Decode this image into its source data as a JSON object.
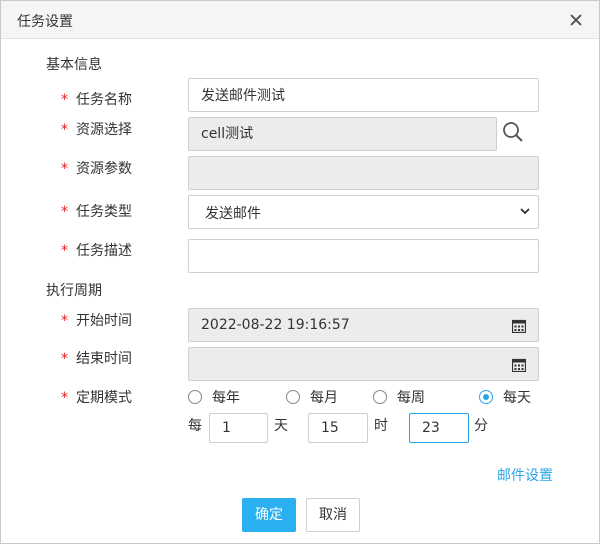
{
  "dialog": {
    "title": "任务设置"
  },
  "basic": {
    "section_title": "基本信息",
    "task_name": {
      "label": "任务名称",
      "value": "发送邮件测试"
    },
    "resource": {
      "label": "资源选择",
      "value": "cell测试"
    },
    "resource_params": {
      "label": "资源参数",
      "value": ""
    },
    "task_type": {
      "label": "任务类型",
      "value": "发送邮件"
    },
    "task_desc": {
      "label": "任务描述",
      "value": ""
    }
  },
  "schedule": {
    "section_title": "执行周期",
    "start_time": {
      "label": "开始时间",
      "value": "2022-08-22 19:16:57"
    },
    "end_time": {
      "label": "结束时间",
      "value": ""
    },
    "mode": {
      "label": "定期模式",
      "options": [
        "每年",
        "每月",
        "每周",
        "每天"
      ],
      "selected": "每天"
    },
    "interval": {
      "prefix": "每",
      "day_value": "1",
      "day_unit": "天",
      "hour_value": "15",
      "hour_unit": "时",
      "minute_value": "23",
      "minute_unit": "分"
    }
  },
  "required_mark": "*",
  "links": {
    "mail_settings": "邮件设置"
  },
  "buttons": {
    "confirm": "确定",
    "cancel": "取消"
  },
  "colors": {
    "accent": "#2aaff0",
    "required": "#e02020",
    "disabled_bg": "#ececec"
  }
}
